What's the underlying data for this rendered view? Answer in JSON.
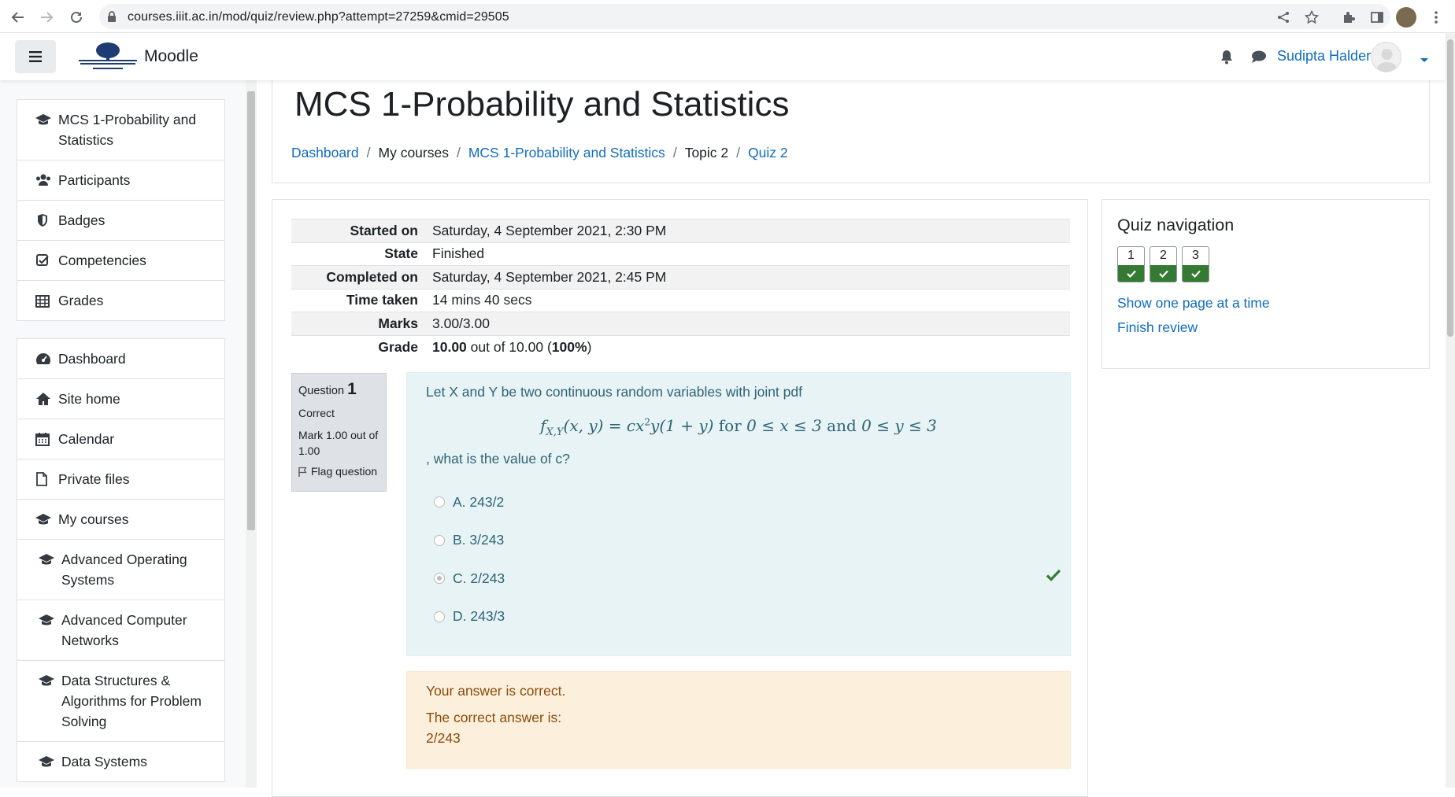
{
  "browser": {
    "url": "courses.iiit.ac.in/mod/quiz/review.php?attempt=27259&cmid=29505"
  },
  "navbar": {
    "site_name": "Moodle",
    "user_name": "Sudipta Halder"
  },
  "drawer": {
    "group1": [
      {
        "label": "MCS 1-Probability and Statistics",
        "icon": "graduation-cap-icon"
      },
      {
        "label": "Participants",
        "icon": "users-icon"
      },
      {
        "label": "Badges",
        "icon": "shield-icon"
      },
      {
        "label": "Competencies",
        "icon": "check-square-icon"
      },
      {
        "label": "Grades",
        "icon": "table-icon"
      }
    ],
    "group2": [
      {
        "label": "Dashboard",
        "icon": "dashboard-icon"
      },
      {
        "label": "Site home",
        "icon": "home-icon"
      },
      {
        "label": "Calendar",
        "icon": "calendar-icon"
      },
      {
        "label": "Private files",
        "icon": "file-icon"
      },
      {
        "label": "My courses",
        "icon": "graduation-cap-icon"
      },
      {
        "label": "Advanced Operating Systems",
        "icon": "graduation-cap-icon"
      },
      {
        "label": "Advanced Computer Networks",
        "icon": "graduation-cap-icon"
      },
      {
        "label": "Data Structures & Algorithms for Problem Solving",
        "icon": "graduation-cap-icon"
      },
      {
        "label": "Data Systems",
        "icon": "graduation-cap-icon"
      }
    ]
  },
  "page": {
    "title": "MCS 1-Probability and Statistics",
    "breadcrumb": [
      "Dashboard",
      "My courses",
      "MCS 1-Probability and Statistics",
      "Topic 2",
      "Quiz 2"
    ]
  },
  "summary": {
    "rows": [
      {
        "label": "Started on",
        "value": "Saturday, 4 September 2021, 2:30 PM"
      },
      {
        "label": "State",
        "value": "Finished"
      },
      {
        "label": "Completed on",
        "value": "Saturday, 4 September 2021, 2:45 PM"
      },
      {
        "label": "Time taken",
        "value": "14 mins 40 secs"
      },
      {
        "label": "Marks",
        "value": "3.00/3.00"
      }
    ],
    "grade_label": "Grade",
    "grade_value": "10.00",
    "grade_out_of": " out of 10.00 (",
    "grade_percent": "100%",
    "grade_close": ")"
  },
  "question": {
    "label": "Question",
    "number": "1",
    "state": "Correct",
    "mark": "Mark 1.00 out of 1.00",
    "flag": "Flag question",
    "text": "Let X and Y be two continuous random variables with joint pdf",
    "formula_lhs": "f",
    "formula_sub": "X,Y",
    "formula_mid": "(x, y) = cx",
    "formula_sup": "2",
    "formula_rest": "y(1 + y)",
    "formula_for": " for ",
    "formula_cond1": "0 ≤ x ≤ 3",
    "formula_and": " and ",
    "formula_cond2": "0 ≤ y ≤ 3",
    "after_text": ", what is the value of c?",
    "options": [
      {
        "label": "A. 243/2",
        "checked": false
      },
      {
        "label": "B. 3/243",
        "checked": false
      },
      {
        "label": "C. 2/243",
        "checked": true
      },
      {
        "label": "D. 243/3",
        "checked": false
      }
    ],
    "feedback": "Your answer is correct.",
    "right_answer_label": "The correct answer is:",
    "right_answer_value": "2/243"
  },
  "quiz_nav": {
    "title": "Quiz navigation",
    "buttons": [
      "1",
      "2",
      "3"
    ],
    "show_one_page": "Show one page at a time",
    "finish_review": "Finish review"
  },
  "colors": {
    "link": "#0f6cbf",
    "correct": "#357a32",
    "formulation_bg": "#e7f3f5",
    "outcome_bg": "#fcefdc"
  }
}
